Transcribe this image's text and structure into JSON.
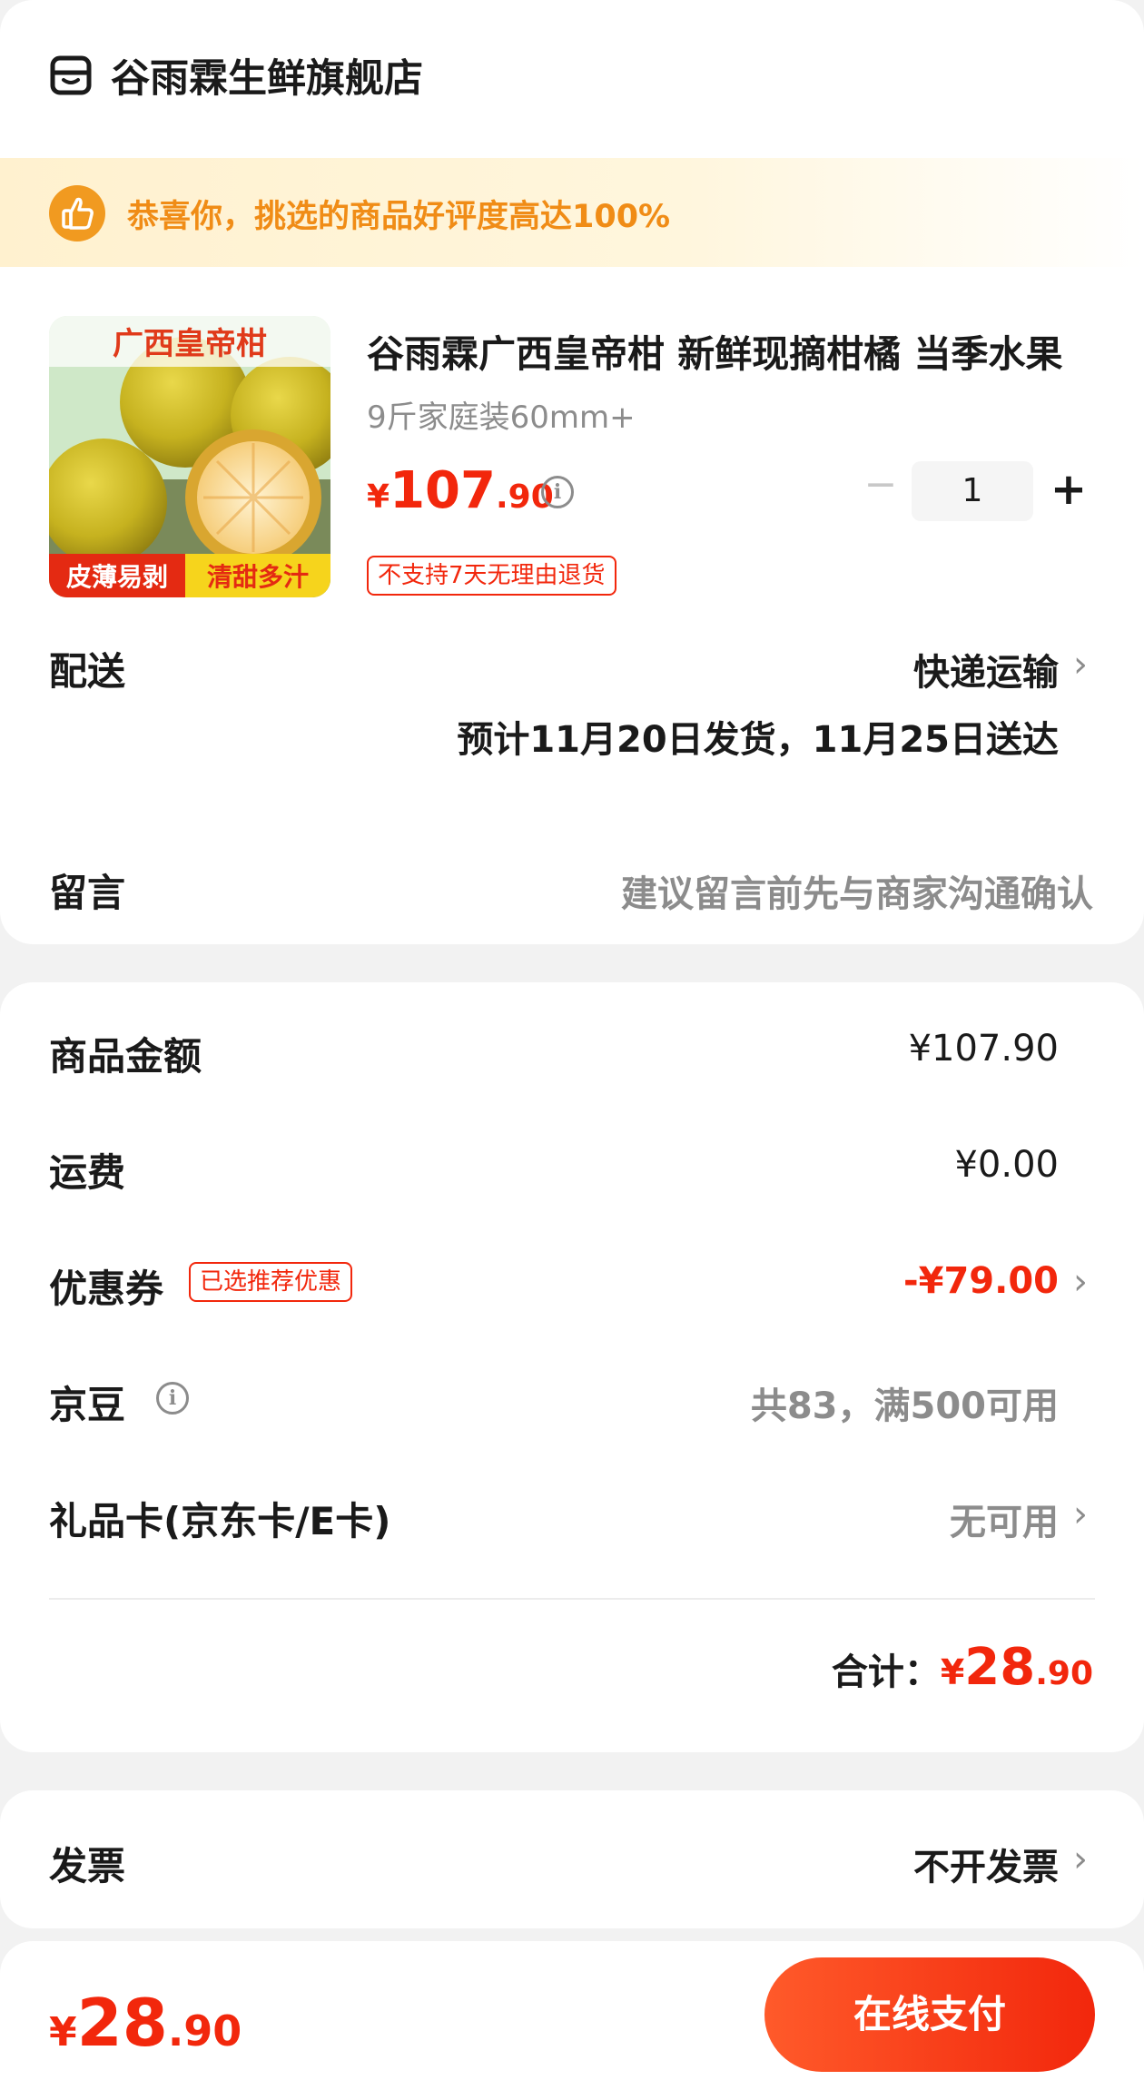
{
  "store": {
    "name": "谷雨霖生鲜旗舰店",
    "icon": "store-icon"
  },
  "banner": {
    "text": "恭喜你，挑选的商品好评度高达100%",
    "icon": "thumbs-up-icon"
  },
  "product": {
    "image_text_top": "广西皇帝柑",
    "image_text_bottom_left": "皮薄易剥",
    "image_text_bottom_right": "清甜多汁",
    "title": "谷雨霖广西皇帝柑 新鲜现摘柑橘 当季水果",
    "spec": "9斤家庭装60mm+",
    "price_currency": "¥",
    "price_int": "107",
    "price_dec": ".90",
    "quantity": "1",
    "qty_minus": "−",
    "qty_plus": "+",
    "return_tag": "不支持7天无理由退货"
  },
  "delivery": {
    "label": "配送",
    "method": "快递运输",
    "estimate": "预计11月20日发货，11月25日送达"
  },
  "message": {
    "label": "留言",
    "placeholder": "建议留言前先与商家沟通确认"
  },
  "summary": {
    "goods_label": "商品金额",
    "goods_value": "¥107.90",
    "shipping_label": "运费",
    "shipping_value": "¥0.00",
    "coupon_label": "优惠券",
    "coupon_tag": "已选推荐优惠",
    "coupon_value": "-¥79.00",
    "jingdou_label": "京豆",
    "jingdou_value": "共83，满500可用",
    "giftcard_label": "礼品卡(京东卡/E卡)",
    "giftcard_value": "无可用",
    "total_label": "合计：",
    "total_currency": "¥",
    "total_int": "28",
    "total_dec": ".90"
  },
  "invoice": {
    "label": "发票",
    "value": "不开发票"
  },
  "footer": {
    "currency": "¥",
    "price_int": "28",
    "price_dec": ".90",
    "pay_button": "在线支付"
  },
  "colors": {
    "accent_red": "#f2270c",
    "banner_orange": "#f08c16",
    "muted_gray": "#8c8c8c"
  }
}
